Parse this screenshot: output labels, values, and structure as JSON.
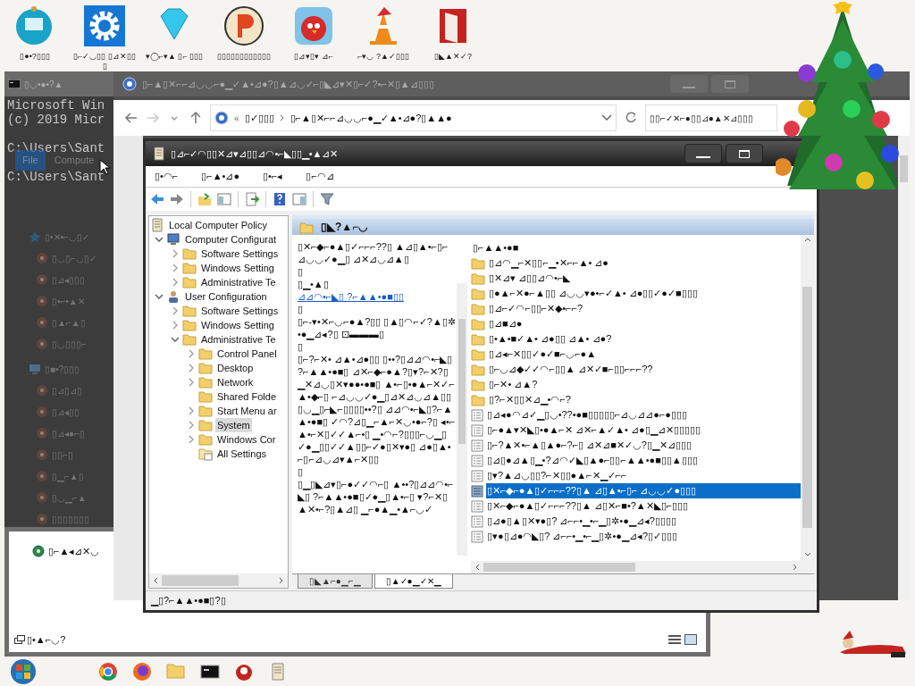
{
  "desktop_icons": [
    {
      "kind": "monitor-ball",
      "label": "▯●•?▯▯▯"
    },
    {
      "kind": "gear",
      "label": "▯⌐✓◡▯▯ ▯⊿✕▯▯▯"
    },
    {
      "kind": "diamond",
      "label": "▾◯⌐▾▲ ▯⌐ ▯▯▯"
    },
    {
      "kind": "round-logo",
      "label": "▯▯▯▯▯▯▯▯▯▯▯▯"
    },
    {
      "kind": "bird",
      "label": "▯⊿▾▯▾ ⊿⌐"
    },
    {
      "kind": "cone",
      "label": "⌐▾◡ ?▲✓▯▯▯"
    },
    {
      "kind": "red-box",
      "label": "▯◣▲✕✓?"
    }
  ],
  "cmd_window": {
    "title": "▯◡•●•?▲",
    "lines": [
      {
        "kind": "output",
        "text": "Microsoft Win"
      },
      {
        "kind": "output",
        "text": "(c) 2019 Micr"
      },
      {
        "kind": "prompt",
        "text": "C:\\Users\\Sant"
      },
      {
        "kind": "prompt",
        "text": "C:\\Users\\Sant"
      }
    ],
    "ghost_tabs": [
      {
        "label": "File",
        "selected": true
      },
      {
        "label": "Compute",
        "selected": false
      }
    ],
    "ghost_nav": [
      {
        "kind": "star",
        "label": "▯•✕•⌐◡▯✓"
      },
      {
        "kind": "drive",
        "label": "▯◡▯⌐◡▯✓"
      },
      {
        "kind": "drive",
        "label": "▯⊿◂▯▯▯"
      },
      {
        "kind": "drive",
        "label": "▯•⌐•▲✕"
      },
      {
        "kind": "drive",
        "label": "▯▲⌐▲▯"
      },
      {
        "kind": "drive",
        "label": "▯◡▯▯▯⌐"
      },
      {
        "kind": "pc",
        "label": "▯■•?▯▯▯"
      },
      {
        "kind": "drive",
        "label": "▯⊿▯⊿▯"
      },
      {
        "kind": "drive",
        "label": "▯⊿◂▯▯"
      },
      {
        "kind": "drive",
        "label": "▯⊿◂●⌐▯"
      },
      {
        "kind": "drive",
        "label": "▯▯⌐▯"
      },
      {
        "kind": "drive",
        "label": "▯▁⌐▲▯"
      },
      {
        "kind": "drive",
        "label": "▯◡▁⌐▲"
      },
      {
        "kind": "drive",
        "label": "▯▯▯▯▯▯▯"
      }
    ]
  },
  "explorer_window": {
    "title": "▯⌐▲▯✕⌐⌐⊿◡◡⌐●▁✓▲•⊿●?▯▲⊿◡✓⌐▯◣⊿▾✕▯⌐✓?•⌐✕▯▲⊿▯▯▯",
    "address_prefix": "«",
    "address_parts": [
      "▯✓▯▯▯",
      "▯⌐▲▯✕⌐⌐⊿◡◡⌐●▁✓▲•⊿●?▯▲▲●"
    ],
    "search_placeholder": "▯▯⌐✓✕⌐●▯▯⊿●▲✕⊿▯▯▯"
  },
  "lower_window": {
    "item": "▯⌐▲◂⊿✕◡",
    "footer": "▯•▲⌐◡?"
  },
  "gpedit_window": {
    "title": "▯⊿⌐✓◠▯▯✕⊿▾⊿▯▯⊿◠•⌐◣▯▯▁•▲⊿✕",
    "menu": [
      "▯•◠⌐",
      "▯⌐▲•⊿●",
      "▯•⌐◂",
      "▯⌐◠⊿"
    ],
    "tree": [
      {
        "kind": "policy",
        "label": "Local Computer Policy",
        "selected": false,
        "children": [
          {
            "kind": "computer",
            "label": "Computer Configurat",
            "expanded": true,
            "selected": false,
            "children": [
              {
                "kind": "folder",
                "label": "Software Settings",
                "expanded": false,
                "selected": false
              },
              {
                "kind": "folder",
                "label": "Windows Setting",
                "expanded": false,
                "selected": false
              },
              {
                "kind": "folder",
                "label": "Administrative Te",
                "expanded": false,
                "selected": false
              }
            ]
          },
          {
            "kind": "user",
            "label": "User Configuration",
            "expanded": true,
            "selected": false,
            "children": [
              {
                "kind": "folder",
                "label": "Software Settings",
                "expanded": false,
                "selected": false
              },
              {
                "kind": "folder",
                "label": "Windows Setting",
                "expanded": false,
                "selected": false
              },
              {
                "kind": "folder",
                "label": "Administrative Te",
                "expanded": true,
                "selected": false,
                "children": [
                  {
                    "kind": "folder",
                    "label": "Control Panel",
                    "expanded": false,
                    "selected": false
                  },
                  {
                    "kind": "folder",
                    "label": "Desktop",
                    "expanded": false,
                    "selected": false
                  },
                  {
                    "kind": "folder",
                    "label": "Network",
                    "expanded": false,
                    "selected": false
                  },
                  {
                    "kind": "folder",
                    "label": "Shared Folde",
                    "selected": false
                  },
                  {
                    "kind": "folder",
                    "label": "Start Menu ar",
                    "expanded": false,
                    "selected": false
                  },
                  {
                    "kind": "folder",
                    "label": "System",
                    "expanded": false,
                    "selected": true
                  },
                  {
                    "kind": "folder",
                    "label": "Windows Cor",
                    "expanded": false,
                    "selected": false
                  },
                  {
                    "kind": "all-settings",
                    "label": "All Settings",
                    "selected": false
                  }
                ]
              }
            ]
          }
        ]
      }
    ],
    "pane_title": "▯◣?▲⌐◡",
    "description": [
      {
        "kind": "text",
        "text": "▯✕⌐◆⌐●▲▯✓⌐⌐⌐??▯ ▲⊿▯▲•⌐▯⌐ ⊿◡◡✓●▁▯ ⊿✕⊿◡⊿▲▯"
      },
      {
        "kind": "text",
        "text": "▯"
      },
      {
        "kind": "text",
        "text": "▯▁•▲▯"
      },
      {
        "kind": "link",
        "text": "⊿⊿◠•⌐◣▯ ?⌐▲▲•●■▯▯"
      },
      {
        "kind": "text",
        "text": "▯"
      },
      {
        "kind": "text",
        "text": "▯⌐-▾•✕⌐◡⌐●▲?▯▯ ▯▲▯◠⌐✓?▲▯✲•●▁⊿◂?▯ ⊡▬▬▬▯"
      },
      {
        "kind": "text",
        "text": "▯"
      },
      {
        "kind": "text",
        "text": "▯⌐?⌐✕• ⊿▲•⊿●▯▯ ▯••?▯⊿⊿◠•⌐◣▯ ?⌐▲▲•●■▯ ⊿✕⌐◆⌐●▲?▯▾?⌐✕?▯ ▁✕⊿◡▯✕▾●●•●■▯ ▲•⌐▯•●▲⌐✕✓⌐▲•◆⌐▯ ⌐⊿◡◡✓●▁▯⊿✕⊿◡⊿▲▯▯ ▯◡▁▯⌐◣⌐▯▯▯▯••?▯ ⊿⊿◠•⌐◣▯?⌐▲▲•●■▯ ✓◠?⊿▯▁⌐▲⌐✕◡•●⌐?▯ ◂•⌐▲•⌐✕▯✓✓▲⌐•▯ ▁•◠⌐?▯▯▯⌐◡▁▯ ✓●▁▯▯✓✓▲▯▯⌐✓●▯✕▾●▯ ⊿●▯▲•⌐▯⌐⊿◡⊿▾▲⌐✕▯▯"
      },
      {
        "kind": "text",
        "text": "▯"
      },
      {
        "kind": "text",
        "text": "▯▁▯◣⊿▾▯⌐●✓✓◠⌐▯ ▲••?▯⊿⊿◠•⌐◣▯ ?⌐▲▲•●■▯✓●▁▯▲•⌐▯ ▾?⌐✕▯▲✕•⌐?▯▲⊿▯ ▁⌐●▲▁•▲⌐◡✓"
      }
    ],
    "list_header": "▯⌐▲▲•●■",
    "list": [
      {
        "kind": "folder",
        "label": "▯⊿◠▁⌐✕▯▯⌐▁•✕⌐⌐▲• ⊿●",
        "selected": false
      },
      {
        "kind": "folder",
        "label": "▯✕⊿▾ ⊿▯▯⊿◠•⌐◣",
        "selected": false
      },
      {
        "kind": "folder",
        "label": "▯●▲⌐✕●⌐▲▯▯ ⊿◡◡▾●•⌐✓▲• ⊿●▯▯✓●✓■▯▯▯",
        "selected": false
      },
      {
        "kind": "folder",
        "label": "▯⊿⌐✓◠⌐▯▯⌐✕◆•⌐⌐?",
        "selected": false
      },
      {
        "kind": "folder",
        "label": "▯⊿■⊿●",
        "selected": false
      },
      {
        "kind": "folder",
        "label": "▯•▲•■✓▲• ⊿●▯▯ ⊿▲• ⊿●?",
        "selected": false
      },
      {
        "kind": "folder",
        "label": "▯⊿◂⌐✕▯▯✓●✓■⌐◡⌐●▲",
        "selected": false
      },
      {
        "kind": "folder",
        "label": "▯⌐◡⊿◆✓✓◠⌐▯▯▲ ⊿✕✓■⌐▯▯⌐⌐⌐??",
        "selected": false
      },
      {
        "kind": "folder",
        "label": "▯⌐✕• ⊿▲?",
        "selected": false
      },
      {
        "kind": "folder",
        "label": "▯?⌐✕▯▯✕⊿▁•◠⌐?",
        "selected": false
      },
      {
        "kind": "setting",
        "label": "▯⊿◂●◠⊿✓▁▯◡•??•●■▯▯▯▯▯⌐⊿◡⊿⊿●⌐●▯▯▯",
        "selected": false
      },
      {
        "kind": "setting",
        "label": "▯⌐●▲▾✕◣▯•●▲⌐✕ ⊿✕⌐▲✓▲• ⊿●▯▁⊿✕▯▯▯▯▯",
        "selected": false
      },
      {
        "kind": "setting",
        "label": "▯⌐?▲✕•⌐▲▯▲●⌐?⌐▯ ⊿✕⊿■✕✓◡?▯▁✕⊿▯▯▯",
        "selected": false
      },
      {
        "kind": "setting",
        "label": "▯⊿▯●⊿▲▯▁•?⊿◠✓◣▯▲●⌐▯▯⌐▲▲•●■▯▯▲▯▯▯",
        "selected": false
      },
      {
        "kind": "setting",
        "label": "▯▾?▲⊿◡▯▯?⌐✕▯▯●▲⌐✕▁✓⌐⌐",
        "selected": false
      },
      {
        "kind": "setting",
        "label": "▯✕⌐◆⌐●▲▯✓⌐⌐⌐??▯▲ ⊿▯▲•⌐▯⌐ ⊿◡◡✓●▯▯▯",
        "selected": true
      },
      {
        "kind": "setting",
        "label": "▯✕⌐◆⌐●▲▯✓⌐⌐⌐??▯▲ ⊿▯✕⌐■•?▲✕◣▯⌐▯▯▯",
        "selected": false
      },
      {
        "kind": "setting",
        "label": "▯⊿●▯▲▯✕▾●▯? ⊿⌐⌐•▁•⌐▁▯✲•●▁⊿◂?▯▯▯▯",
        "selected": false
      },
      {
        "kind": "setting",
        "label": "▯▾●▯⊿●◠◣▯? ⊿⌐⌐•▁•⌐▁▯✲•●▁⊿◂?▯✓▯▯▯",
        "selected": false
      }
    ],
    "tabs": [
      {
        "label": "▯◣▲⌐●▁⌐▁",
        "selected": false
      },
      {
        "label": "▯▲✓●▁✓✕▁",
        "selected": true
      }
    ],
    "status": "▁▯?⌐▲▲•●■▯?▯"
  }
}
